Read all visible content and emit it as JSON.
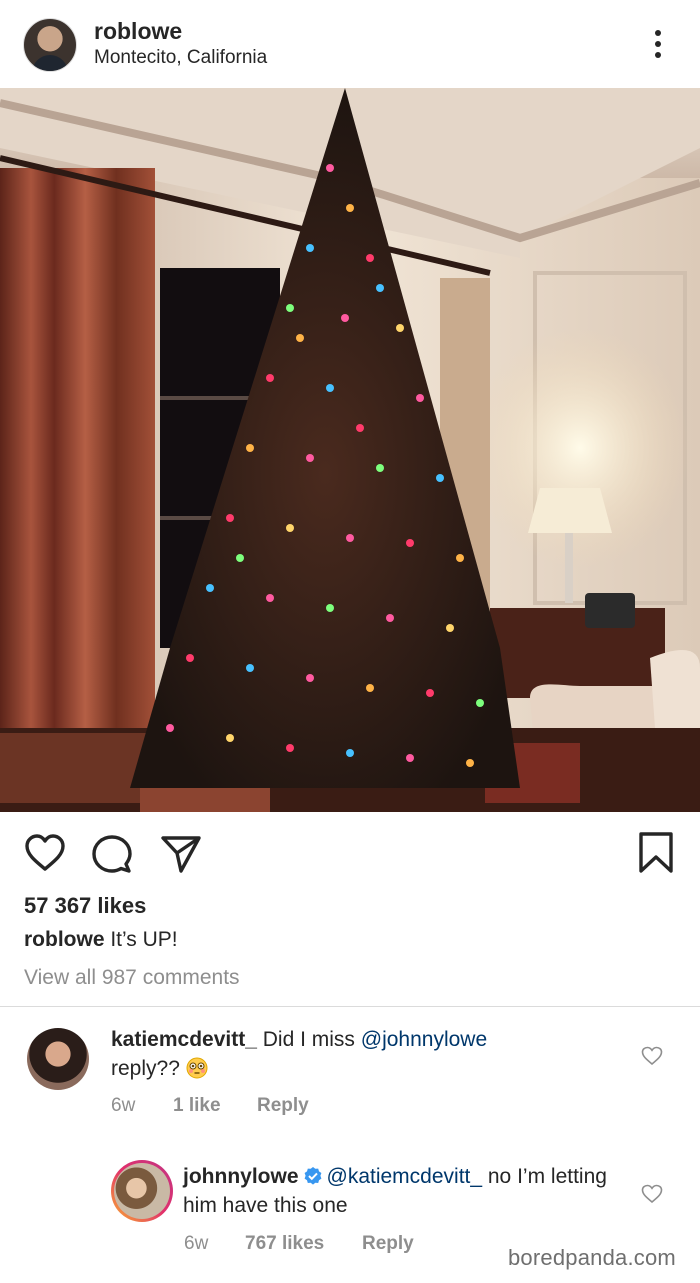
{
  "post": {
    "username": "roblowe",
    "location": "Montecito, California",
    "likes": "57 367 likes",
    "caption_user": "roblowe",
    "caption_text": " It’s UP!",
    "view_all": "View all 987 comments"
  },
  "comments": [
    {
      "username": "katiemcdevitt_",
      "text_before": " Did I miss ",
      "mention": "@johnnylowe",
      "text_after": "reply?? ",
      "emoji": "flushed-face-emoji",
      "age": "6w",
      "likes": "1 like",
      "reply_label": "Reply"
    },
    {
      "username": "johnnylowe",
      "verified": true,
      "mention": "@katiemcdevitt_",
      "text_after": " no I’m letting him have this one",
      "age": "6w",
      "likes": "767 likes",
      "reply_label": "Reply"
    }
  ],
  "watermark": "boredpanda.com",
  "colors": {
    "text": "#262626",
    "secondary": "#8e8e8e",
    "mention": "#00376b",
    "verified": "#3897f0"
  },
  "icons": [
    "more-options-icon",
    "heart-icon",
    "comment-icon",
    "share-icon",
    "bookmark-icon",
    "verified-badge-icon"
  ]
}
